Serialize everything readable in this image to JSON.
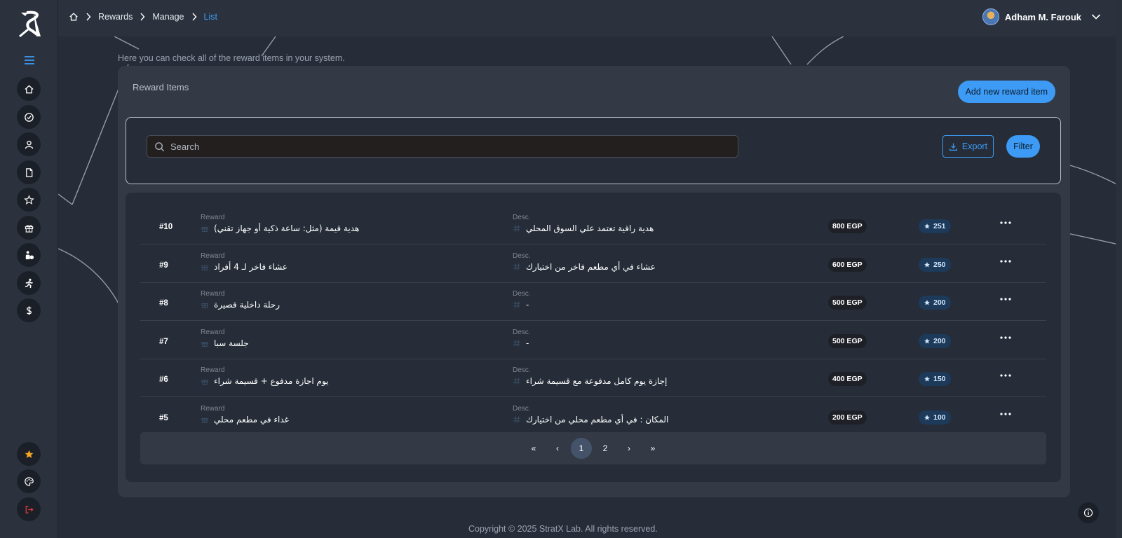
{
  "breadcrumb": {
    "items": [
      "Rewards",
      "Manage"
    ],
    "current": "List"
  },
  "user": {
    "name": "Adham M. Farouk"
  },
  "page": {
    "subtitle": "Here you can check all of the reward items in your system."
  },
  "panel": {
    "title": "Reward Items",
    "add_label": "Add new reward item"
  },
  "search": {
    "placeholder": "Search"
  },
  "toolbar": {
    "export_label": "Export",
    "filter_label": "Filter"
  },
  "labels": {
    "reward": "Reward",
    "desc": "Desc."
  },
  "rows": [
    {
      "id": "#10",
      "reward": "هدية قيمة (مثل: ساعة ذكية أو جهاز تقني)",
      "desc": "هدية راقية تعتمد علي السوق المحلي",
      "price": "800 EGP",
      "points": "251"
    },
    {
      "id": "#9",
      "reward": "عشاء فاخر لـ 4 أفراد",
      "desc": "عشاء في أي مطعم فاخر من اختيارك",
      "price": "600 EGP",
      "points": "250"
    },
    {
      "id": "#8",
      "reward": "رحلة داخلية قصيرة",
      "desc": "-",
      "price": "500 EGP",
      "points": "200"
    },
    {
      "id": "#7",
      "reward": "جلسة سبا",
      "desc": "-",
      "price": "500 EGP",
      "points": "200"
    },
    {
      "id": "#6",
      "reward": "يوم اجازة مدفوع + قسيمة شراء",
      "desc": "إجازة يوم كامل مدفوعة مع قسيمة شراء",
      "price": "400 EGP",
      "points": "150"
    },
    {
      "id": "#5",
      "reward": "غداء في مطعم محلي",
      "desc": "المكان : في أي مطعم محلي من اختيارك",
      "price": "200 EGP",
      "points": "100"
    }
  ],
  "pagination": {
    "first": "«",
    "prev": "‹",
    "pages": [
      "1",
      "2"
    ],
    "current": "1",
    "next": "›",
    "last": "»"
  },
  "footer": {
    "copyright": "Copyright © 2025 StratX Lab. All rights reserved."
  },
  "colors": {
    "accent": "#3d9bf5",
    "background": "#262d38",
    "panel": "#333a46",
    "logout": "#d63a3a",
    "star": "#f5a623"
  },
  "sidebar": {
    "icons": [
      "home-icon",
      "check-circle-icon",
      "user-icon",
      "document-icon",
      "star-icon",
      "gift-icon",
      "person-badge-icon",
      "runner-icon",
      "dollar-icon",
      "favorite-star-icon",
      "palette-icon",
      "logout-icon"
    ]
  }
}
